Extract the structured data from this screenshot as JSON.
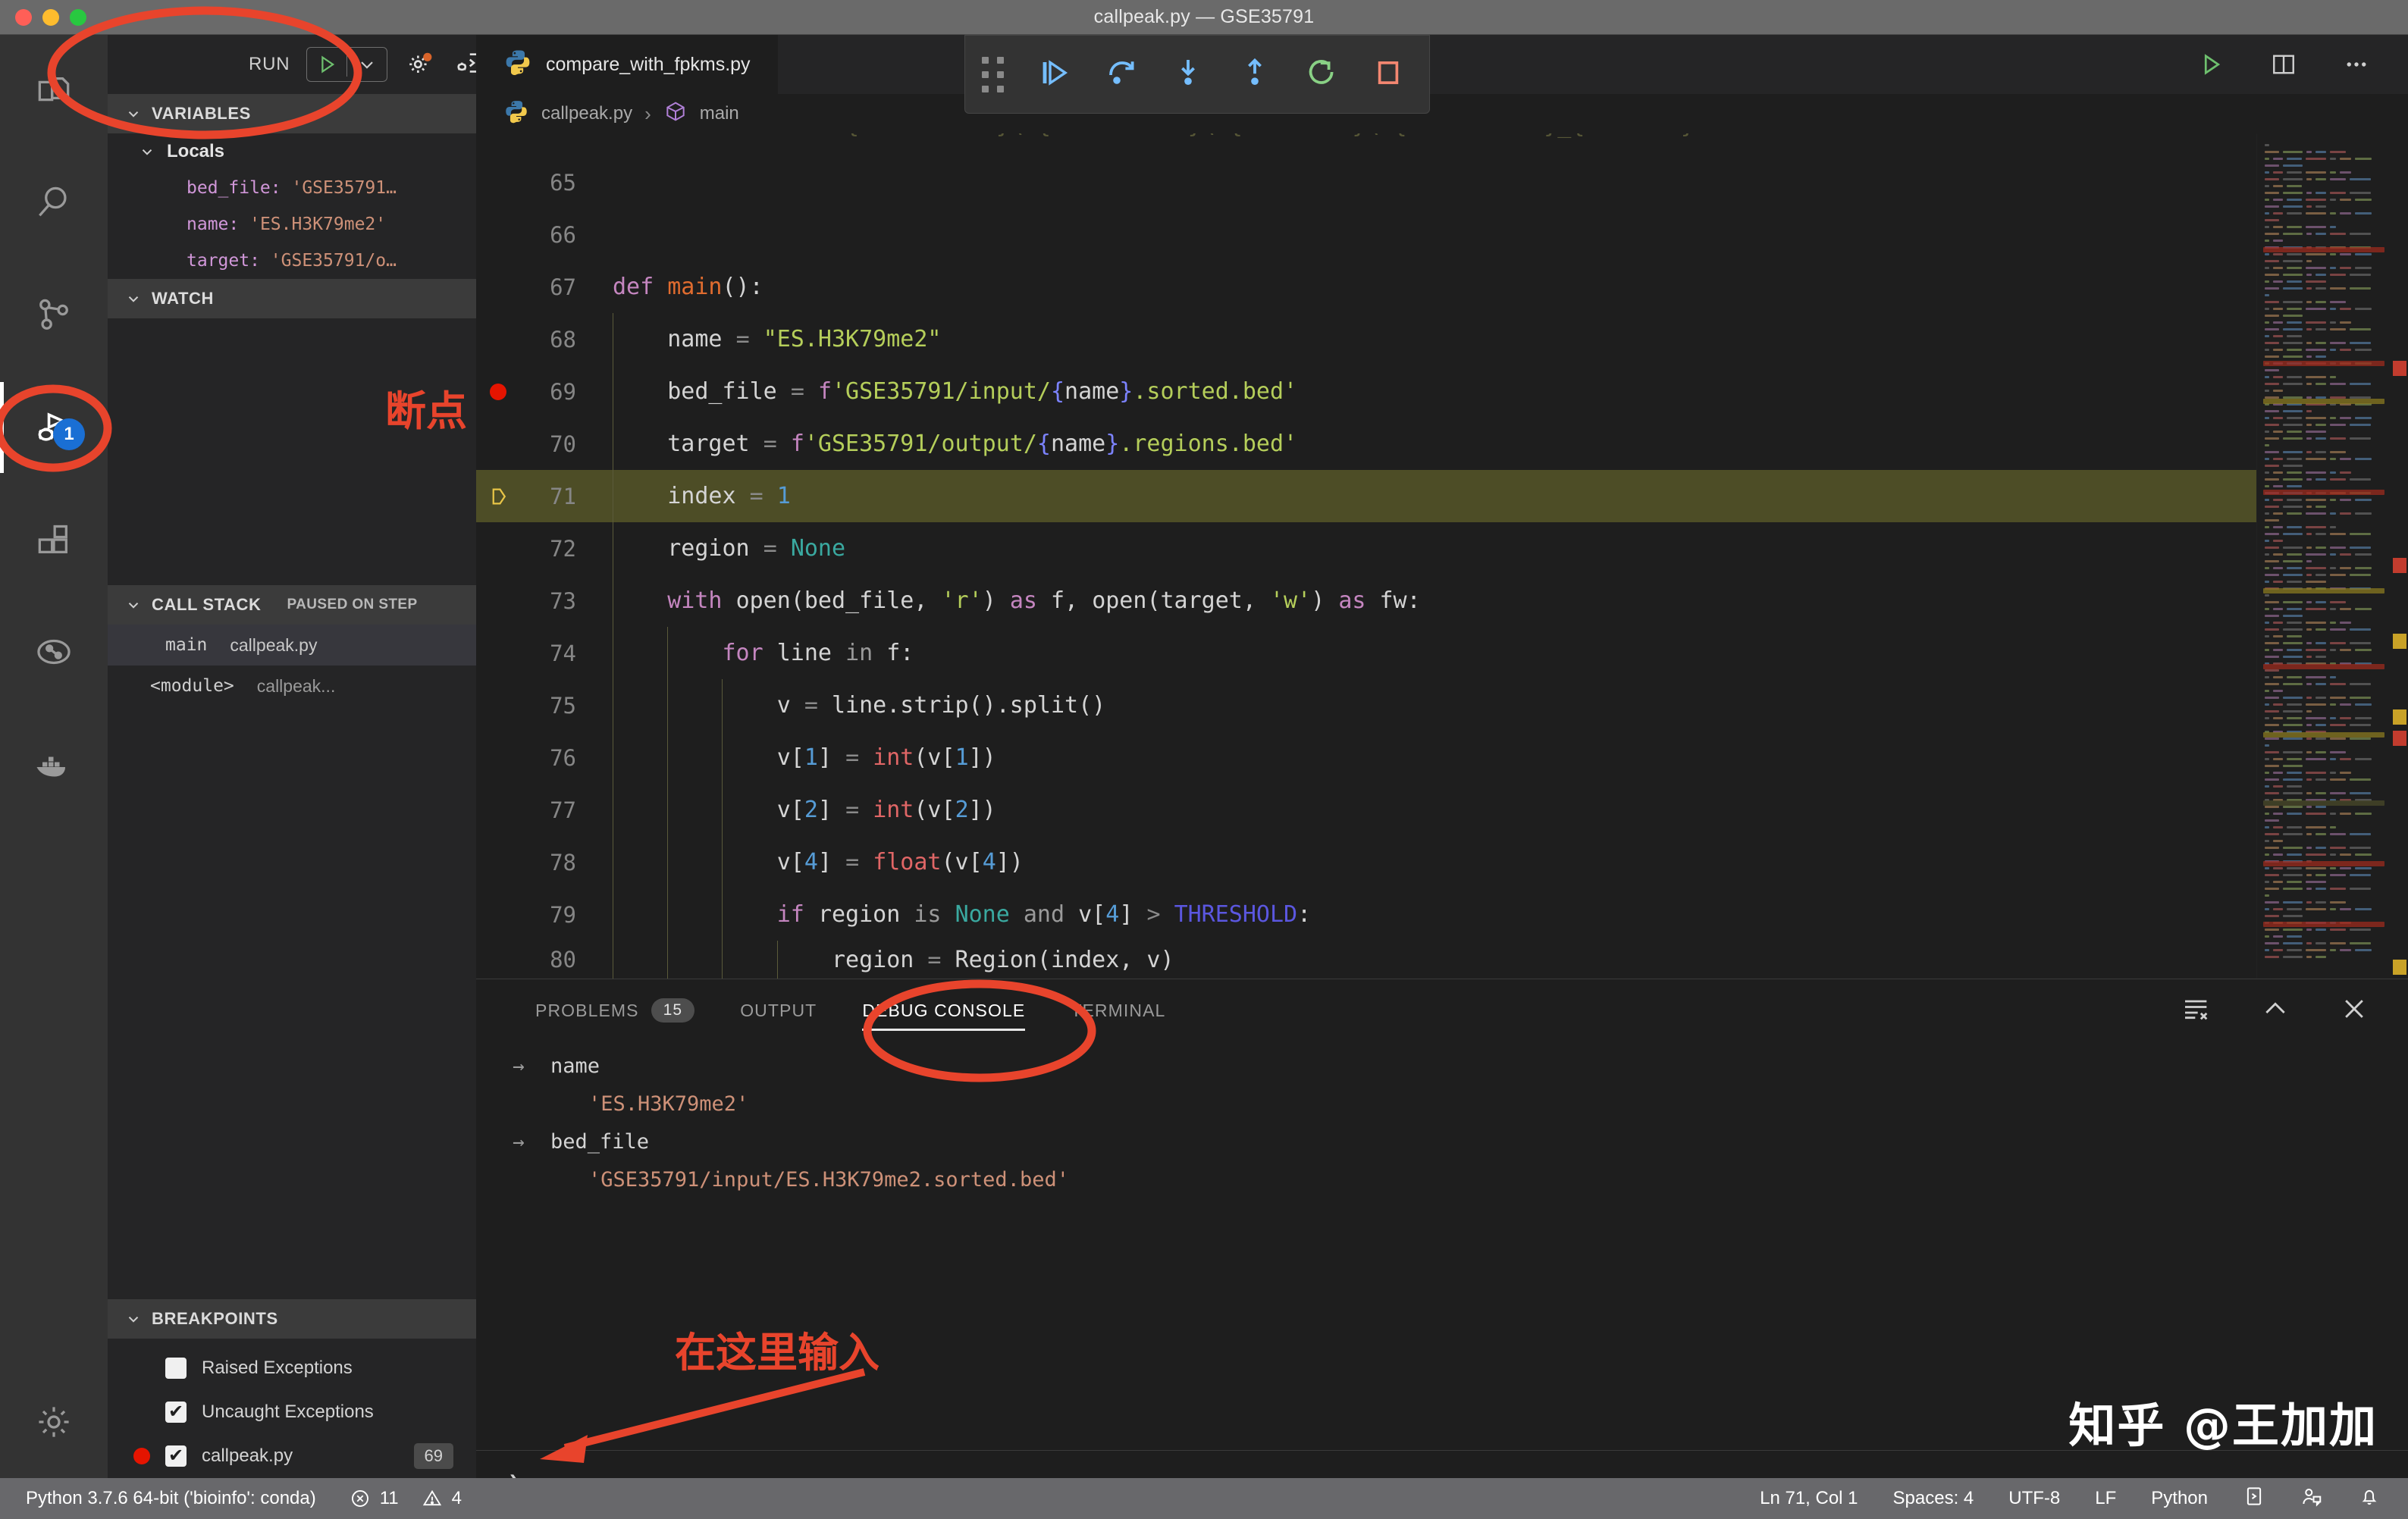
{
  "window": {
    "title": "callpeak.py — GSE35791",
    "traffic_lights": [
      "close",
      "minimize",
      "maximize"
    ]
  },
  "activity_bar": {
    "items": [
      {
        "name": "explorer",
        "icon": "files-icon",
        "active": false
      },
      {
        "name": "search",
        "icon": "search-icon",
        "active": false
      },
      {
        "name": "source-control",
        "icon": "source-control-icon",
        "active": false
      },
      {
        "name": "run-and-debug",
        "icon": "run-debug-icon",
        "active": true,
        "badge": "1"
      },
      {
        "name": "extensions",
        "icon": "extensions-icon",
        "active": false
      },
      {
        "name": "testing",
        "icon": "testing-icon",
        "active": false
      },
      {
        "name": "docker",
        "icon": "docker-icon",
        "active": false
      }
    ],
    "bottom": [
      {
        "name": "manage",
        "icon": "gear-icon"
      }
    ]
  },
  "sidebar": {
    "run_header": {
      "label": "RUN",
      "start_icon": "play-icon",
      "dropdown_icon": "chevron-down-icon",
      "config_icon": "gear-dot-icon",
      "debug_console_icon": "open-debug-console-icon"
    },
    "variables": {
      "title": "VARIABLES",
      "scopes": [
        {
          "name": "Locals",
          "vars": [
            {
              "key": "bed_file:",
              "value": "'GSE35791…"
            },
            {
              "key": "name:",
              "value": "'ES.H3K79me2'"
            },
            {
              "key": "target:",
              "value": "'GSE35791/o…"
            }
          ]
        }
      ]
    },
    "watch": {
      "title": "WATCH",
      "items": []
    },
    "call_stack": {
      "title": "CALL STACK",
      "status": "PAUSED ON STEP",
      "frames": [
        {
          "fn": "main",
          "file": "callpeak.py",
          "selected": true
        },
        {
          "fn": "<module>",
          "file": "callpeak...",
          "selected": false
        }
      ]
    },
    "breakpoints": {
      "title": "BREAKPOINTS",
      "items": [
        {
          "label": "Raised Exceptions",
          "checked": false,
          "dot": false,
          "line": ""
        },
        {
          "label": "Uncaught Exceptions",
          "checked": true,
          "dot": false,
          "line": ""
        },
        {
          "label": "callpeak.py",
          "checked": true,
          "dot": true,
          "line": "69"
        }
      ]
    }
  },
  "editor": {
    "tabs": [
      {
        "label": "compare_with_fpkms.py",
        "icon": "python-icon",
        "active": true
      }
    ],
    "tab_actions": [
      {
        "name": "run-python-file",
        "icon": "play-icon"
      },
      {
        "name": "split-editor",
        "icon": "split-editor-icon"
      },
      {
        "name": "more-actions",
        "icon": "ellipsis-icon"
      }
    ],
    "breadcrumb": {
      "file_icon": "python-icon",
      "file": "callpeak.py",
      "separator": "›",
      "symbol_icon": "symbol-method-icon",
      "symbol": "main"
    },
    "first_visible_line": 65,
    "lines": [
      {
        "num": 65,
        "tokens": []
      },
      {
        "num": 66,
        "tokens": []
      },
      {
        "num": 67,
        "tokens": [
          {
            "t": "def ",
            "c": "t-kw"
          },
          {
            "t": "main",
            "c": "t-fname"
          },
          {
            "t": "():",
            "c": "t-plain"
          }
        ]
      },
      {
        "num": 68,
        "tokens": [
          {
            "t": "    name ",
            "c": "t-plain"
          },
          {
            "t": "= ",
            "c": "t-op"
          },
          {
            "t": "\"ES.H3K79me2\"",
            "c": "t-str"
          }
        ]
      },
      {
        "num": 69,
        "breakpoint": true,
        "tokens": [
          {
            "t": "    bed_file ",
            "c": "t-plain"
          },
          {
            "t": "= ",
            "c": "t-op"
          },
          {
            "t": "f",
            "c": "t-fpre"
          },
          {
            "t": "'GSE35791/input/",
            "c": "t-str"
          },
          {
            "t": "{",
            "c": "t-brace"
          },
          {
            "t": "name",
            "c": "t-plain"
          },
          {
            "t": "}",
            "c": "t-brace"
          },
          {
            "t": ".sorted.bed'",
            "c": "t-str"
          }
        ]
      },
      {
        "num": 70,
        "tokens": [
          {
            "t": "    target ",
            "c": "t-plain"
          },
          {
            "t": "= ",
            "c": "t-op"
          },
          {
            "t": "f",
            "c": "t-fpre"
          },
          {
            "t": "'GSE35791/output/",
            "c": "t-str"
          },
          {
            "t": "{",
            "c": "t-brace"
          },
          {
            "t": "name",
            "c": "t-plain"
          },
          {
            "t": "}",
            "c": "t-brace"
          },
          {
            "t": ".regions.bed'",
            "c": "t-str"
          }
        ]
      },
      {
        "num": 71,
        "current": true,
        "tokens": [
          {
            "t": "    index ",
            "c": "t-plain"
          },
          {
            "t": "= ",
            "c": "t-op"
          },
          {
            "t": "1",
            "c": "t-num"
          }
        ]
      },
      {
        "num": 72,
        "tokens": [
          {
            "t": "    region ",
            "c": "t-plain"
          },
          {
            "t": "= ",
            "c": "t-op"
          },
          {
            "t": "None",
            "c": "t-none"
          }
        ]
      },
      {
        "num": 73,
        "tokens": [
          {
            "t": "    with ",
            "c": "t-kw"
          },
          {
            "t": "open",
            "c": "t-plain"
          },
          {
            "t": "(bed_file, ",
            "c": "t-plain"
          },
          {
            "t": "'r'",
            "c": "t-str"
          },
          {
            "t": ") ",
            "c": "t-plain"
          },
          {
            "t": "as ",
            "c": "t-kw"
          },
          {
            "t": "f, ",
            "c": "t-plain"
          },
          {
            "t": "open",
            "c": "t-plain"
          },
          {
            "t": "(target, ",
            "c": "t-plain"
          },
          {
            "t": "'w'",
            "c": "t-str"
          },
          {
            "t": ") ",
            "c": "t-plain"
          },
          {
            "t": "as ",
            "c": "t-kw"
          },
          {
            "t": "fw:",
            "c": "t-plain"
          }
        ]
      },
      {
        "num": 74,
        "tokens": [
          {
            "t": "        for ",
            "c": "t-kw"
          },
          {
            "t": "line ",
            "c": "t-plain"
          },
          {
            "t": "in ",
            "c": "t-dim"
          },
          {
            "t": "f:",
            "c": "t-plain"
          }
        ]
      },
      {
        "num": 75,
        "tokens": [
          {
            "t": "            v ",
            "c": "t-plain"
          },
          {
            "t": "= ",
            "c": "t-op"
          },
          {
            "t": "line.strip().split()",
            "c": "t-plain"
          }
        ]
      },
      {
        "num": 76,
        "tokens": [
          {
            "t": "            v[",
            "c": "t-plain"
          },
          {
            "t": "1",
            "c": "t-num"
          },
          {
            "t": "] ",
            "c": "t-plain"
          },
          {
            "t": "= ",
            "c": "t-op"
          },
          {
            "t": "int",
            "c": "t-builtin"
          },
          {
            "t": "(v[",
            "c": "t-plain"
          },
          {
            "t": "1",
            "c": "t-num"
          },
          {
            "t": "])",
            "c": "t-plain"
          }
        ]
      },
      {
        "num": 77,
        "tokens": [
          {
            "t": "            v[",
            "c": "t-plain"
          },
          {
            "t": "2",
            "c": "t-num"
          },
          {
            "t": "] ",
            "c": "t-plain"
          },
          {
            "t": "= ",
            "c": "t-op"
          },
          {
            "t": "int",
            "c": "t-builtin"
          },
          {
            "t": "(v[",
            "c": "t-plain"
          },
          {
            "t": "2",
            "c": "t-num"
          },
          {
            "t": "])",
            "c": "t-plain"
          }
        ]
      },
      {
        "num": 78,
        "tokens": [
          {
            "t": "            v[",
            "c": "t-plain"
          },
          {
            "t": "4",
            "c": "t-num"
          },
          {
            "t": "] ",
            "c": "t-plain"
          },
          {
            "t": "= ",
            "c": "t-op"
          },
          {
            "t": "float",
            "c": "t-builtin"
          },
          {
            "t": "(v[",
            "c": "t-plain"
          },
          {
            "t": "4",
            "c": "t-num"
          },
          {
            "t": "])",
            "c": "t-plain"
          }
        ]
      },
      {
        "num": 79,
        "tokens": [
          {
            "t": "            if ",
            "c": "t-kw"
          },
          {
            "t": "region ",
            "c": "t-plain"
          },
          {
            "t": "is ",
            "c": "t-dim"
          },
          {
            "t": "None ",
            "c": "t-none"
          },
          {
            "t": "and ",
            "c": "t-dim"
          },
          {
            "t": "v[",
            "c": "t-plain"
          },
          {
            "t": "4",
            "c": "t-num"
          },
          {
            "t": "] ",
            "c": "t-plain"
          },
          {
            "t": "> ",
            "c": "t-op"
          },
          {
            "t": "THRESHOLD",
            "c": "t-const"
          },
          {
            "t": ":",
            "c": "t-plain"
          }
        ]
      },
      {
        "num": 80,
        "partial": true,
        "tokens": [
          {
            "t": "                region ",
            "c": "t-plain"
          },
          {
            "t": "= ",
            "c": "t-op"
          },
          {
            "t": "Region",
            "c": "t-plain"
          },
          {
            "t": "(index, v)",
            "c": "t-plain"
          }
        ]
      }
    ]
  },
  "panel": {
    "tabs": [
      {
        "label": "PROBLEMS",
        "badge": "15",
        "active": false
      },
      {
        "label": "OUTPUT",
        "badge": "",
        "active": false
      },
      {
        "label": "DEBUG CONSOLE",
        "badge": "",
        "active": true
      },
      {
        "label": "TERMINAL",
        "badge": "",
        "active": false
      }
    ],
    "actions": [
      {
        "name": "clear-console-button",
        "icon": "clear-all-icon"
      },
      {
        "name": "maximize-panel-button",
        "icon": "chevron-up-icon"
      },
      {
        "name": "close-panel-button",
        "icon": "close-icon"
      }
    ],
    "console_lines": [
      {
        "arrow": "→",
        "text": "name",
        "kind": "expr"
      },
      {
        "arrow": "",
        "text": "'ES.H3K79me2'",
        "kind": "val"
      },
      {
        "arrow": "→",
        "text": "bed_file",
        "kind": "expr"
      },
      {
        "arrow": "",
        "text": "'GSE35791/input/ES.H3K79me2.sorted.bed'",
        "kind": "val"
      }
    ],
    "repl": {
      "prompt": "›",
      "value": "",
      "placeholder": ""
    }
  },
  "debug_toolbar": {
    "buttons": [
      {
        "name": "drag-handle",
        "icon": "grip-icon",
        "color": "#8a8a8a"
      },
      {
        "name": "continue-button",
        "icon": "continue-icon",
        "color": "#75beff"
      },
      {
        "name": "step-over-button",
        "icon": "step-over-icon",
        "color": "#75beff"
      },
      {
        "name": "step-into-button",
        "icon": "step-into-icon",
        "color": "#75beff"
      },
      {
        "name": "step-out-button",
        "icon": "step-out-icon",
        "color": "#75beff"
      },
      {
        "name": "restart-button",
        "icon": "restart-icon",
        "color": "#89d185"
      },
      {
        "name": "stop-button",
        "icon": "stop-icon",
        "color": "#f48771"
      }
    ]
  },
  "status_bar": {
    "left": [
      {
        "name": "python-interpreter",
        "label": "Python 3.7.6 64-bit ('bioinfo': conda)",
        "icon": ""
      },
      {
        "name": "problems-count",
        "label": "11",
        "icon": "error-icon"
      },
      {
        "name": "warnings-count",
        "label": "4",
        "icon": "warning-icon"
      }
    ],
    "right": [
      {
        "name": "cursor-position",
        "label": "Ln 71, Col 1"
      },
      {
        "name": "indentation",
        "label": "Spaces: 4"
      },
      {
        "name": "encoding",
        "label": "UTF-8"
      },
      {
        "name": "eol",
        "label": "LF"
      },
      {
        "name": "language-mode",
        "label": "Python"
      },
      {
        "name": "open-terminal-button",
        "label": "",
        "icon": "terminal-icon"
      },
      {
        "name": "live-share-button",
        "label": "",
        "icon": "live-share-icon"
      },
      {
        "name": "notifications-button",
        "label": "",
        "icon": "bell-icon"
      }
    ]
  },
  "annotations": {
    "breakpoint_label": "断点",
    "input_here_label": "在这里输入",
    "accent_color": "#e8442c",
    "highlights": [
      {
        "name": "run-button-ellipse",
        "target": "run-button-group"
      },
      {
        "name": "debug-activity-ellipse",
        "target": "run-and-debug-activity-item"
      },
      {
        "name": "debug-console-tab-ellipse",
        "target": "debug-console-tab"
      }
    ]
  },
  "watermark": {
    "text": "知乎 @王加加"
  }
}
